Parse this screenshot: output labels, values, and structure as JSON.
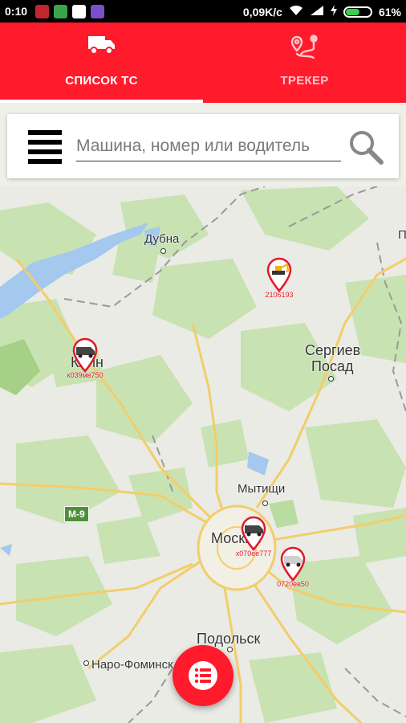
{
  "statusbar": {
    "time": "0:10",
    "speed": "0,09K/c",
    "battery": "61%",
    "battery_level": 0.61,
    "battery_color": "#37d24a"
  },
  "app": {
    "accent_color": "#ff1a2c",
    "tabs": [
      {
        "label": "СПИСОК ТС",
        "icon": "truck-icon",
        "active": true
      },
      {
        "label": "ТРЕКЕР",
        "icon": "route-icon",
        "active": false
      }
    ]
  },
  "search": {
    "placeholder": "Машина, номер или водитель",
    "value": ""
  },
  "map": {
    "places": {
      "dubna": "Дубна",
      "sergiev": "Сергиев",
      "posad": "Посад",
      "klin": "Клин",
      "mytishchi": "Мытищи",
      "moskva": "Москва",
      "podolsk": "Подольск",
      "naro": "Наро-Фоминск",
      "edge": "П"
    },
    "road_shield": "М-9",
    "vehicles": [
      {
        "plate": "2106193",
        "icon": "excavator-icon"
      },
      {
        "plate": "к039мв750",
        "icon": "van-icon"
      },
      {
        "plate": "х070ее777",
        "icon": "van-icon"
      },
      {
        "plate": "0720ев50",
        "icon": "van-icon"
      }
    ]
  },
  "fab": {
    "icon": "list-icon"
  }
}
